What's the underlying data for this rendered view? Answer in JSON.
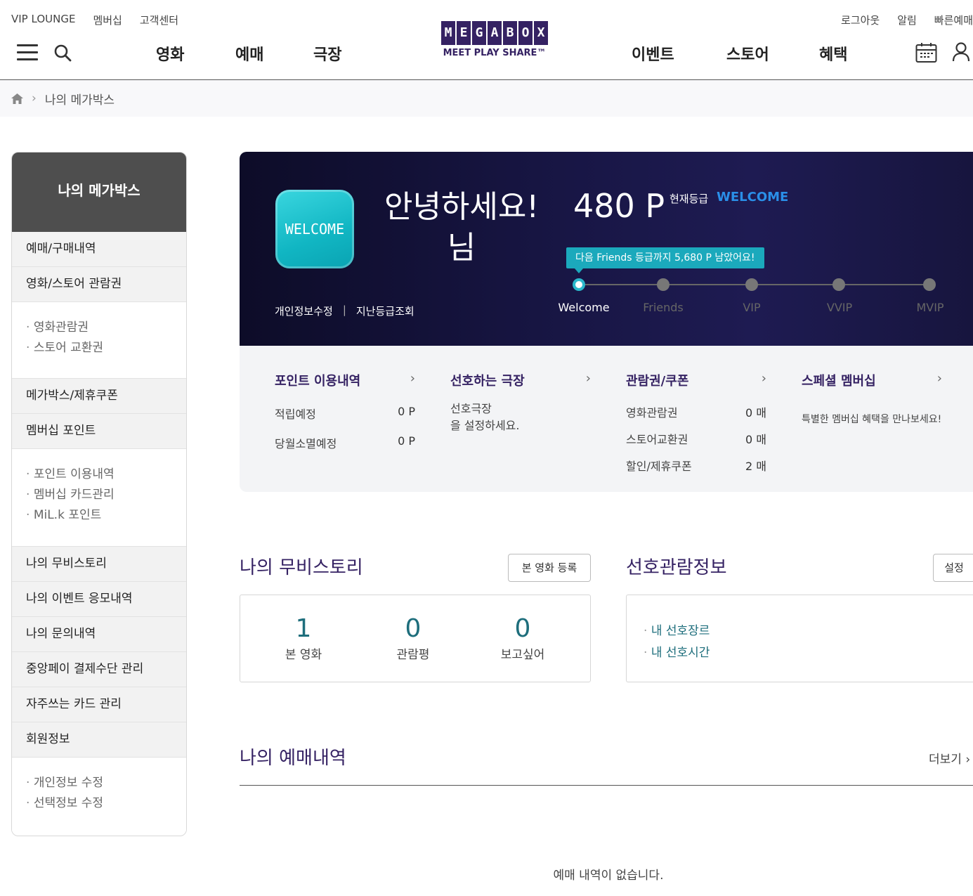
{
  "header": {
    "util_left": [
      "VIP LOUNGE",
      "멤버십",
      "고객센터"
    ],
    "util_right": [
      "로그아웃",
      "알림",
      "빠른예매"
    ],
    "nav_left": [
      "영화",
      "예매",
      "극장"
    ],
    "nav_right": [
      "이벤트",
      "스토어",
      "혜택"
    ],
    "logo_letters": [
      "M",
      "E",
      "G",
      "A",
      "B",
      "O",
      "X"
    ],
    "logo_tagline": "MEET PLAY SHARE™"
  },
  "breadcrumb": {
    "current": "나의 메가박스"
  },
  "sidebar": {
    "title": "나의 메가박스",
    "item_booking": "예매/구매내역",
    "item_tickets": "영화/스토어 관람권",
    "sub_tickets": [
      "영화관람권",
      "스토어 교환권"
    ],
    "item_coupon": "메가박스/제휴쿠폰",
    "item_points": "멤버십 포인트",
    "sub_points": [
      "포인트 이용내역",
      "멤버십 카드관리",
      "MiL.k 포인트"
    ],
    "item_story": "나의 무비스토리",
    "item_event": "나의 이벤트 응모내역",
    "item_inquiry": "나의 문의내역",
    "item_pay": "중앙페이 결제수단 관리",
    "item_card": "자주쓰는 카드 관리",
    "item_member": "회원정보",
    "sub_member": [
      "개인정보 수정",
      "선택정보 수정"
    ]
  },
  "profile": {
    "badge": "WELCOME",
    "greeting": "안녕하세요!",
    "name_suffix": "님",
    "link_edit": "개인정보수정",
    "link_divider": "|",
    "link_history": "지난등급조회",
    "points": "480 P",
    "grade_label": "현재등급",
    "grade_value": "WELCOME",
    "tooltip": "다음 Friends 등급까지 5,680 P 남았어요!",
    "levels": [
      "Welcome",
      "Friends",
      "VIP",
      "VVIP",
      "MVIP"
    ],
    "active_level_index": 0
  },
  "summary": {
    "points": {
      "title": "포인트 이용내역",
      "rows": [
        {
          "label": "적립예정",
          "value": "0 P"
        },
        {
          "label": "당월소멸예정",
          "value": "0 P"
        }
      ]
    },
    "theater": {
      "title": "선호하는 극장",
      "text_1": "선호극장",
      "text_2": "을 설정하세요."
    },
    "coupons": {
      "title": "관람권/쿠폰",
      "rows": [
        {
          "label": "영화관람권",
          "value": "0 매"
        },
        {
          "label": "스토어교환권",
          "value": "0 매"
        },
        {
          "label": "할인/제휴쿠폰",
          "value": "2 매"
        }
      ]
    },
    "special": {
      "title": "스페셜 멤버십",
      "text": "특별한 멤버십 혜택을 만나보세요!"
    },
    "chevron": "›"
  },
  "movie_story": {
    "title": "나의 무비스토리",
    "button": "본 영화 등록",
    "stats": [
      {
        "value": "1",
        "label": "본 영화"
      },
      {
        "value": "0",
        "label": "관람평"
      },
      {
        "value": "0",
        "label": "보고싶어"
      }
    ]
  },
  "preference": {
    "title": "선호관람정보",
    "button": "설정",
    "items": [
      "내 선호장르",
      "내 선호시간"
    ]
  },
  "reservations": {
    "title": "나의 예매내역",
    "more": "더보기 ›",
    "empty": "예매 내역이 없습니다."
  }
}
